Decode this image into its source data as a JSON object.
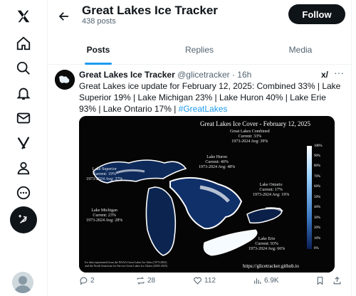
{
  "profile": {
    "title": "Great Lakes Ice Tracker",
    "posts": "438 posts",
    "follow_label": "Follow"
  },
  "tabs": [
    {
      "label": "Posts",
      "active": true
    },
    {
      "label": "Replies",
      "active": false
    },
    {
      "label": "Media",
      "active": false
    }
  ],
  "tweet": {
    "name": "Great Lakes Ice Tracker",
    "handle_time": "@glicetracker · 16h",
    "text": "Great Lakes ice update for February 12, 2025: Combined 33% | Lake Superior 19% | Lake Michigan 23% | Lake Huron 40% | Lake Erie 93% | Lake Ontario 17% | ",
    "hashtag": "#GreatLakes",
    "grok": "x/",
    "more": "···"
  },
  "media": {
    "title": "Great Lakes Ice Cover - February 12, 2025",
    "combined": [
      "Great Lakes Combined",
      "Current: 33%",
      "1973-2024 Avg: 39%"
    ],
    "superior": [
      "Lake Superior",
      "Current: 19%",
      "1973-2024 Avg: 37%"
    ],
    "huron": [
      "Lake Huron",
      "Current: 40%",
      "1973-2024 Avg: 48%"
    ],
    "ontario": [
      "Lake Ontario",
      "Current: 17%",
      "1973-2024 Avg: 19%"
    ],
    "michigan": [
      "Lake Michigan",
      "Current: 23%",
      "1973-2024 Avg: 28%"
    ],
    "erie": [
      "Lake Erie",
      "Current: 93%",
      "1973-2024 Avg: 66%"
    ],
    "legend": [
      "100%",
      "90%",
      "80%",
      "70%",
      "60%",
      "50%",
      "40%",
      "30%",
      "20%",
      "10%",
      "0%"
    ],
    "url": "https://glicetracker.github.io",
    "footnote": [
      "Ice data represented from the NOAA Great Lakes Ice Atlas (1973-2002)",
      "and the North American Ice Service Great Lakes Ice Charts (2003-2025)"
    ]
  },
  "actions": {
    "replies": "2",
    "reposts": "28",
    "likes": "112",
    "views": "6.9K"
  },
  "colors": {
    "accent": "#1d9bf0",
    "text": "#0f1419",
    "muted": "#536471"
  }
}
